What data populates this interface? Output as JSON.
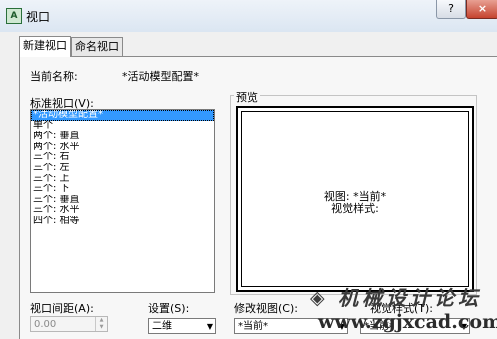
{
  "window": {
    "title": "视口",
    "app_icon": "autocad-icon",
    "help_glyph": "?",
    "close_glyph": "×"
  },
  "tabs": [
    "新建视口",
    "命名视口"
  ],
  "current_name": {
    "label": "当前名称:",
    "value": "*活动模型配置*"
  },
  "standard_viewports": {
    "label": "标准视口(V):",
    "items": [
      "*活动模型配置*",
      "单个",
      "两个: 垂直",
      "两个: 水平",
      "三个: 右",
      "三个: 左",
      "三个: 上",
      "三个: 下",
      "三个: 垂直",
      "三个: 水平",
      "四个: 相等"
    ],
    "selected_index": 0
  },
  "preview": {
    "label": "预览",
    "line1": "视图: *当前*",
    "line2": "视觉样式:"
  },
  "viewport_spacing": {
    "label": "视口间距(A):",
    "value": "0.00"
  },
  "setup": {
    "label": "设置(S):",
    "value": "二维"
  },
  "change_view": {
    "label": "修改视图(C):",
    "value": "*当前*"
  },
  "visual_style": {
    "label": "视觉样式(T):",
    "value": "*当前*"
  },
  "watermark": {
    "text": "机械设计论坛",
    "url": "www.zgjxcad.com"
  }
}
